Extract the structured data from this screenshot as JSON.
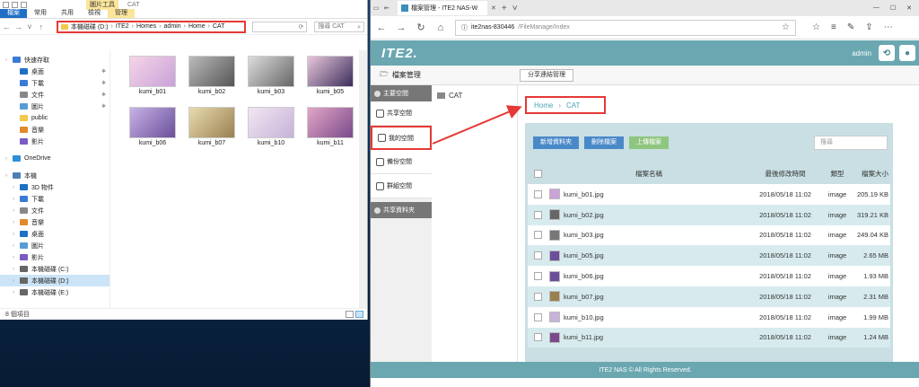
{
  "explorer": {
    "title": "CAT",
    "context_group": "圖片工具",
    "ribbon_tabs": [
      "檔案",
      "常用",
      "共用",
      "檢視",
      "管理"
    ],
    "path": [
      "本機磁碟 (D:)",
      "ITE2",
      "Homes",
      "admin",
      "Home",
      "CAT"
    ],
    "search_placeholder": "搜尋 CAT",
    "tree": [
      {
        "label": "快速存取",
        "icon": "star-icon"
      },
      {
        "label": "桌面",
        "icon": "desktop-icon"
      },
      {
        "label": "下載",
        "icon": "download-icon"
      },
      {
        "label": "文件",
        "icon": "document-icon"
      },
      {
        "label": "圖片",
        "icon": "picture-icon"
      },
      {
        "label": "public",
        "icon": "folder-icon"
      },
      {
        "label": "音樂",
        "icon": "music-icon"
      },
      {
        "label": "影片",
        "icon": "video-icon"
      },
      {
        "label": "OneDrive",
        "icon": "cloud-icon"
      },
      {
        "label": "本機",
        "icon": "pc-icon"
      },
      {
        "label": "3D 物件",
        "icon": "cube-icon"
      },
      {
        "label": "下載",
        "icon": "download-icon"
      },
      {
        "label": "文件",
        "icon": "document-icon"
      },
      {
        "label": "音樂",
        "icon": "music-icon"
      },
      {
        "label": "桌面",
        "icon": "desktop-icon"
      },
      {
        "label": "圖片",
        "icon": "picture-icon"
      },
      {
        "label": "影片",
        "icon": "video-icon"
      },
      {
        "label": "本機磁碟 (C:)",
        "icon": "drive-icon"
      },
      {
        "label": "本機磁碟 (D:)",
        "icon": "drive-icon"
      },
      {
        "label": "本機磁碟 (E:)",
        "icon": "drive-icon"
      }
    ],
    "thumbnails": [
      "kumi_b01",
      "kumi_b02",
      "kumi_b03",
      "kumi_b05",
      "kumi_b06",
      "kumi_b07",
      "kumi_b10",
      "kumi_b11"
    ],
    "status": "8 個項目"
  },
  "browser": {
    "tab_title": "檔案管理 - ITE2 NAS-W",
    "url_host": "ite2nas-830446",
    "url_path": "/FileManage/Index"
  },
  "app": {
    "logo": "ITE2.",
    "user": "admin",
    "file_manage_label": "檔案管理",
    "share_link_button": "分享連結管理",
    "sidebar": {
      "main_group": "主要空間",
      "items": [
        "共享空間",
        "我的空間",
        "備份空間",
        "群組空間"
      ],
      "shared_group": "共享資料夾"
    },
    "tree_node": "CAT",
    "breadcrumb": [
      "Home",
      "CAT"
    ],
    "buttons": {
      "new_folder": "新增資料夾",
      "delete": "刪除檔案",
      "upload": "上傳檔案"
    },
    "search_placeholder": "搜尋",
    "table": {
      "headers": {
        "name": "檔案名稱",
        "time": "最後修改時間",
        "type": "類型",
        "size": "檔案大小"
      },
      "rows": [
        {
          "name": "kumi_b01.jpg",
          "time": "2018/05/18 11:02",
          "type": "image",
          "size": "205.19 KB"
        },
        {
          "name": "kumi_b02.jpg",
          "time": "2018/05/18 11:02",
          "type": "image",
          "size": "319.21 KB"
        },
        {
          "name": "kumi_b03.jpg",
          "time": "2018/05/18 11:02",
          "type": "image",
          "size": "249.04 KB"
        },
        {
          "name": "kumi_b05.jpg",
          "time": "2018/05/18 11:02",
          "type": "image",
          "size": "2.65 MB"
        },
        {
          "name": "kumi_b06.jpg",
          "time": "2018/05/18 11:02",
          "type": "image",
          "size": "1.93 MB"
        },
        {
          "name": "kumi_b07.jpg",
          "time": "2018/05/18 11:02",
          "type": "image",
          "size": "2.31 MB"
        },
        {
          "name": "kumi_b10.jpg",
          "time": "2018/05/18 11:02",
          "type": "image",
          "size": "1.99 MB"
        },
        {
          "name": "kumi_b11.jpg",
          "time": "2018/05/18 11:02",
          "type": "image",
          "size": "1.24 MB"
        }
      ]
    },
    "footer": "ITE2 NAS © All Rights Reserved."
  },
  "colors": {
    "accent": "#6aa7b1",
    "highlight": "#e53935",
    "button_blue": "#4a89c8",
    "button_green": "#8fc67f"
  }
}
